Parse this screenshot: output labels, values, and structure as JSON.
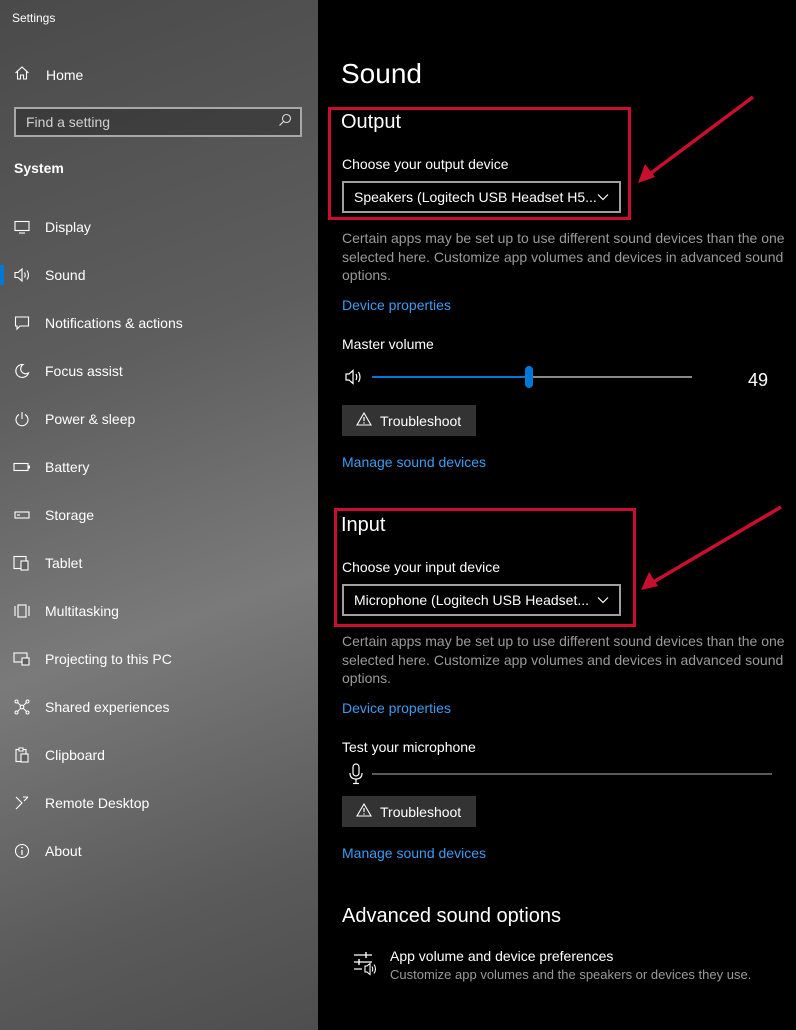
{
  "window": {
    "title": "Settings"
  },
  "sidebar": {
    "home_label": "Home",
    "search_placeholder": "Find a setting",
    "section_title": "System",
    "items": [
      {
        "label": "Display",
        "icon": "monitor-icon"
      },
      {
        "label": "Sound",
        "icon": "speaker-icon",
        "active": true
      },
      {
        "label": "Notifications & actions",
        "icon": "notification-icon"
      },
      {
        "label": "Focus assist",
        "icon": "moon-icon"
      },
      {
        "label": "Power & sleep",
        "icon": "power-icon"
      },
      {
        "label": "Battery",
        "icon": "battery-icon"
      },
      {
        "label": "Storage",
        "icon": "storage-icon"
      },
      {
        "label": "Tablet",
        "icon": "tablet-icon"
      },
      {
        "label": "Multitasking",
        "icon": "multitasking-icon"
      },
      {
        "label": "Projecting to this PC",
        "icon": "projecting-icon"
      },
      {
        "label": "Shared experiences",
        "icon": "shared-icon"
      },
      {
        "label": "Clipboard",
        "icon": "clipboard-icon"
      },
      {
        "label": "Remote Desktop",
        "icon": "remote-desktop-icon"
      },
      {
        "label": "About",
        "icon": "info-icon"
      }
    ]
  },
  "main": {
    "title": "Sound",
    "output": {
      "heading": "Output",
      "device_label": "Choose your output device",
      "device_value": "Speakers (Logitech USB Headset H5...",
      "description": "Certain apps may be set up to use different sound devices than the one selected here. Customize app volumes and devices in advanced sound options.",
      "device_properties": "Device properties",
      "master_volume_label": "Master volume",
      "master_volume_value": "49",
      "volume_level": 0.49,
      "troubleshoot": "Troubleshoot",
      "manage_devices": "Manage sound devices"
    },
    "input": {
      "heading": "Input",
      "device_label": "Choose your input device",
      "device_value": "Microphone (Logitech USB Headset...",
      "description": "Certain apps may be set up to use different sound devices than the one selected here. Customize app volumes and devices in advanced sound options.",
      "device_properties": "Device properties",
      "test_label": "Test your microphone",
      "troubleshoot": "Troubleshoot",
      "manage_devices": "Manage sound devices"
    },
    "advanced": {
      "heading": "Advanced sound options",
      "item_title": "App volume and device preferences",
      "item_desc": "Customize app volumes and the speakers or devices they use."
    }
  },
  "colors": {
    "accent": "#0078d7",
    "link": "#3b9cf2",
    "highlight": "#c8102e"
  }
}
